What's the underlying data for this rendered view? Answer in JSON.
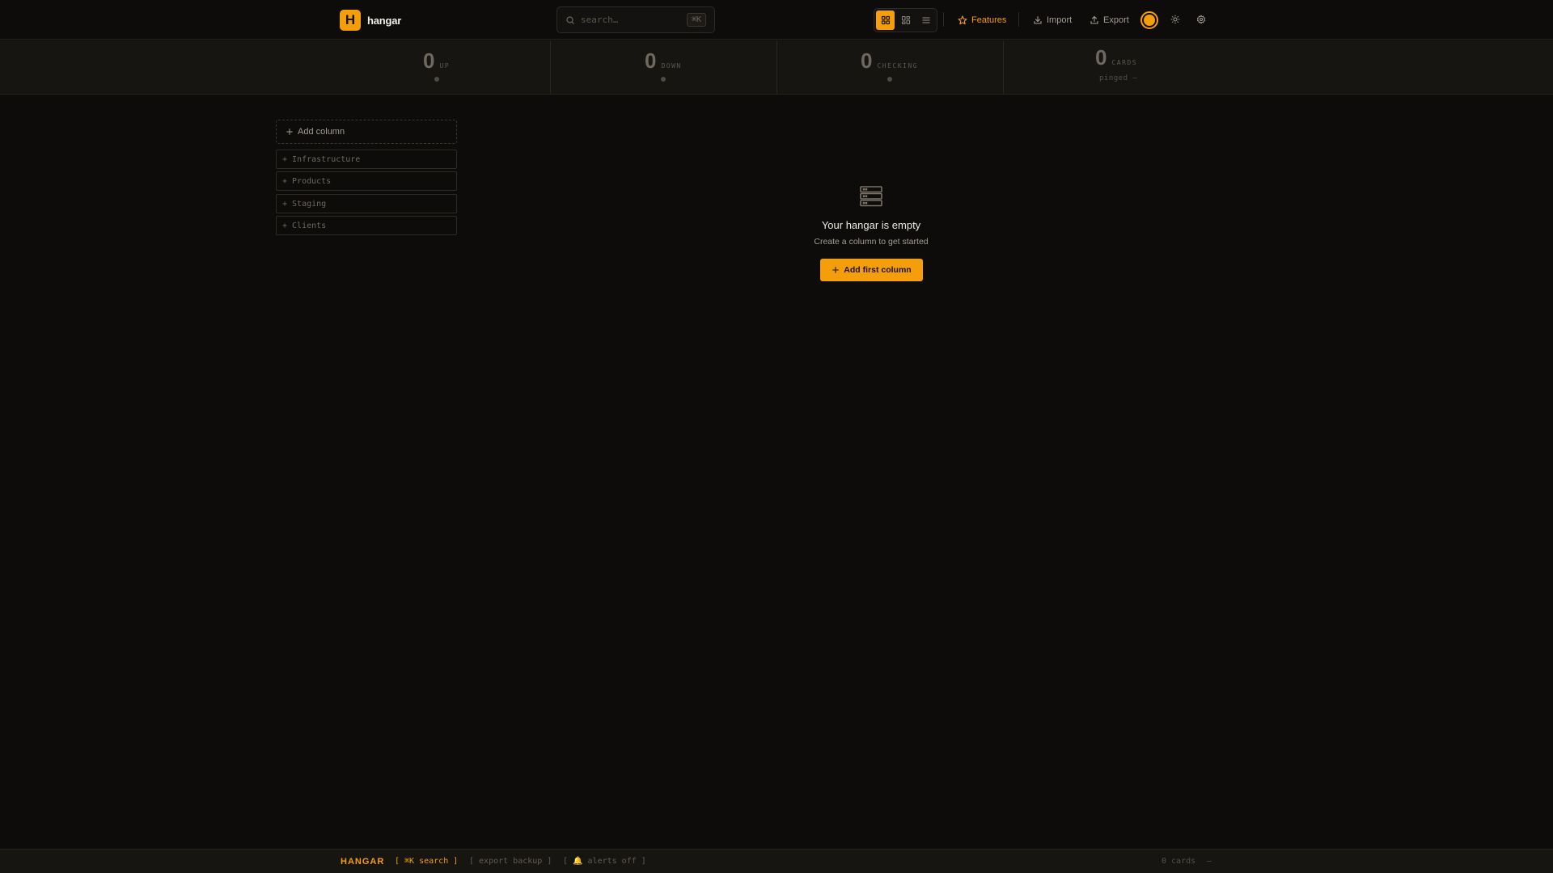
{
  "brand": {
    "logo_letter": "H",
    "name": "hangar"
  },
  "search": {
    "placeholder": "search…",
    "shortcut": "⌘K"
  },
  "view_modes": [
    {
      "icon": "grid-icon",
      "active": true
    },
    {
      "icon": "dashboard-icon",
      "active": false
    },
    {
      "icon": "list-icon",
      "active": false
    }
  ],
  "header_actions": {
    "features_label": "Features",
    "import_label": "Import",
    "export_label": "Export"
  },
  "stats": [
    {
      "value": "0",
      "label": "UP"
    },
    {
      "value": "0",
      "label": "DOWN"
    },
    {
      "value": "0",
      "label": "CHECKING"
    },
    {
      "value": "0",
      "label": "CARDS",
      "sub": "pinged —"
    }
  ],
  "sidebar": {
    "add_column_label": "Add column",
    "suggestions": [
      {
        "label": "+ Infrastructure"
      },
      {
        "label": "+ Products"
      },
      {
        "label": "+ Staging"
      },
      {
        "label": "+ Clients"
      }
    ]
  },
  "empty_state": {
    "title": "Your hangar is empty",
    "subtitle": "Create a column to get started",
    "button_label": "Add first column"
  },
  "footer": {
    "brand": "HANGAR",
    "search_hint": "[ ⌘K search ]",
    "export_hint": "[ export backup ]",
    "alerts_hint": "[ 🔔 alerts off ]",
    "cards_count": "0 cards",
    "status": "—"
  },
  "colors": {
    "accent": "#f59e0b",
    "background": "#0d0c0a",
    "panel": "#171512"
  }
}
